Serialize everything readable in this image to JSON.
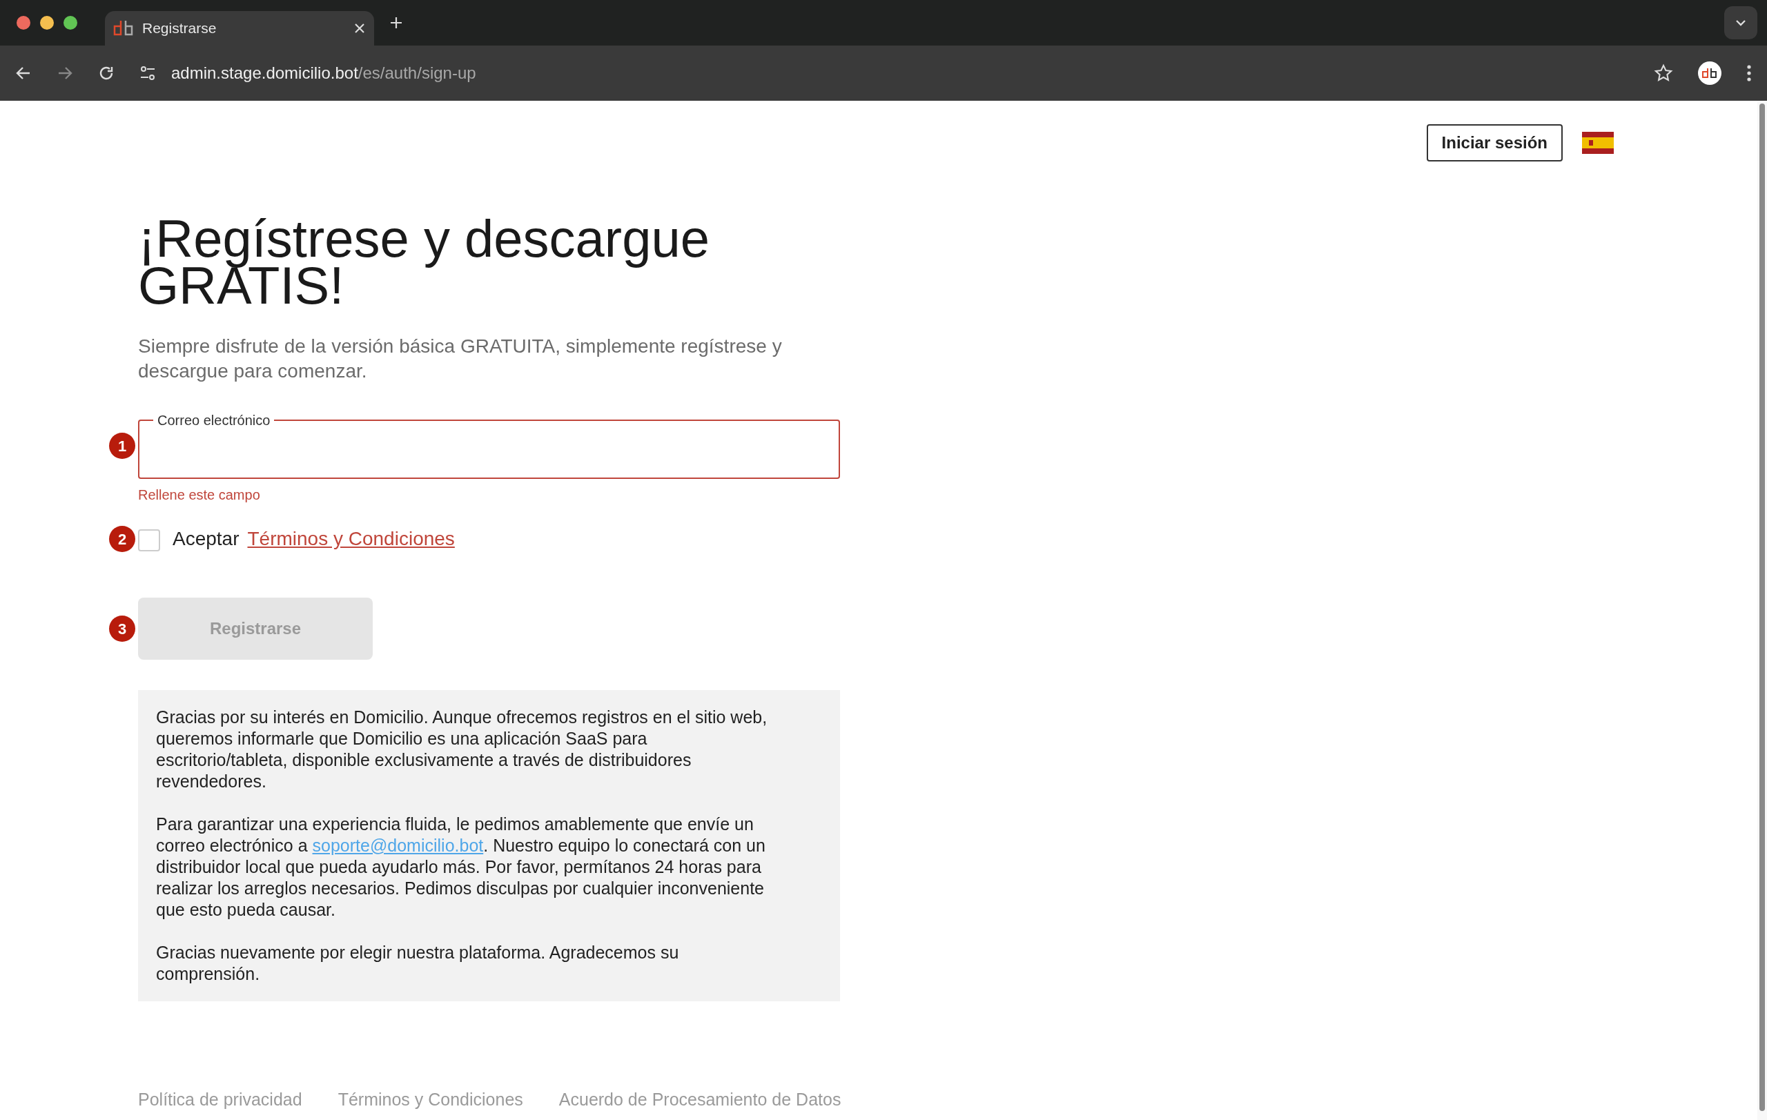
{
  "browser": {
    "tab": {
      "title": "Registrarse",
      "selected": true
    },
    "url": {
      "host": "admin.stage.domicilio.bot",
      "path": "/es/auth/sign-up"
    }
  },
  "header": {
    "login_button": "Iniciar sesión"
  },
  "heading": "¡Regístrese y descargue GRATIS!",
  "subtitle": "Siempre disfrute de la versión básica GRATUITA, simplemente regístrese y descargue para comenzar.",
  "email_field": {
    "step": "1",
    "label": "Correo electrónico",
    "invalid": true,
    "error": "Rellene este campo"
  },
  "terms": {
    "step": "2",
    "checked": false,
    "text": "Aceptar",
    "link": "Términos y Condiciones"
  },
  "submit": {
    "step": "3",
    "label": "Registrarse",
    "disabled": true
  },
  "info": [
    {
      "text": "Gracias por su interés en Domicilio. Aunque ofrecemos registros en el sitio web, queremos informarle que Domicilio es una aplicación SaaS para escritorio/tableta, disponible exclusivamente a través de distribuidores revendedores."
    },
    {
      "text": "Para garantizar una experiencia fluida, le pedimos amablemente que envíe un correo electrónico a ",
      "link": "soporte@domicilio.bot",
      "after": ". Nuestro equipo lo conectará con un distribuidor local que pueda ayudarlo más. Por favor, permítanos 24 horas para realizar los arreglos necesarios. Pedimos disculpas por cualquier inconveniente que esto pueda causar."
    },
    {
      "text": "Gracias nuevamente por elegir nuestra plataforma. Agradecemos su comprensión."
    }
  ],
  "footer": [
    "Política de privacidad",
    "Términos y Condiciones",
    "Acuerdo de Procesamiento de Datos"
  ]
}
